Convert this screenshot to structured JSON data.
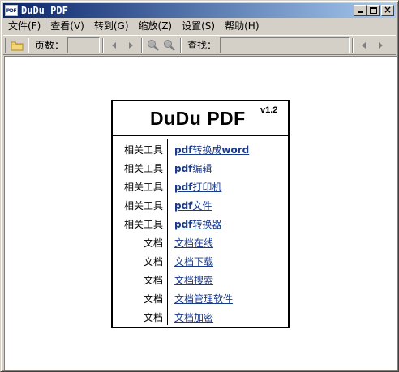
{
  "window": {
    "icon_text": "PDF",
    "title": "DuDu PDF"
  },
  "menu": [
    {
      "label": "文件(F)"
    },
    {
      "label": "查看(V)"
    },
    {
      "label": "转到(G)"
    },
    {
      "label": "缩放(Z)"
    },
    {
      "label": "设置(S)"
    },
    {
      "label": "帮助(H)"
    }
  ],
  "toolbar": {
    "page_label": "页数：",
    "page_value": "",
    "find_label": "查找：",
    "find_value": ""
  },
  "info": {
    "brand": "DuDu PDF",
    "version": "v1.2",
    "rows": [
      {
        "category": "相关工具",
        "link_bold": "pdf",
        "link_rest": "转换成",
        "link_bold2": "word"
      },
      {
        "category": "相关工具",
        "link_bold": "pdf",
        "link_rest": "编辑",
        "link_bold2": ""
      },
      {
        "category": "相关工具",
        "link_bold": "pdf",
        "link_rest": "打印机",
        "link_bold2": ""
      },
      {
        "category": "相关工具",
        "link_bold": "pdf",
        "link_rest": "文件",
        "link_bold2": ""
      },
      {
        "category": "相关工具",
        "link_bold": "pdf",
        "link_rest": "转换器",
        "link_bold2": ""
      },
      {
        "category": "文档",
        "link_bold": "",
        "link_rest": "文档在线",
        "link_bold2": ""
      },
      {
        "category": "文档",
        "link_bold": "",
        "link_rest": "文档下载",
        "link_bold2": ""
      },
      {
        "category": "文档",
        "link_bold": "",
        "link_rest": "文档搜索",
        "link_bold2": ""
      },
      {
        "category": "文档",
        "link_bold": "",
        "link_rest": "文档管理软件",
        "link_bold2": ""
      },
      {
        "category": "文档",
        "link_bold": "",
        "link_rest": "文档加密",
        "link_bold2": ""
      }
    ]
  }
}
